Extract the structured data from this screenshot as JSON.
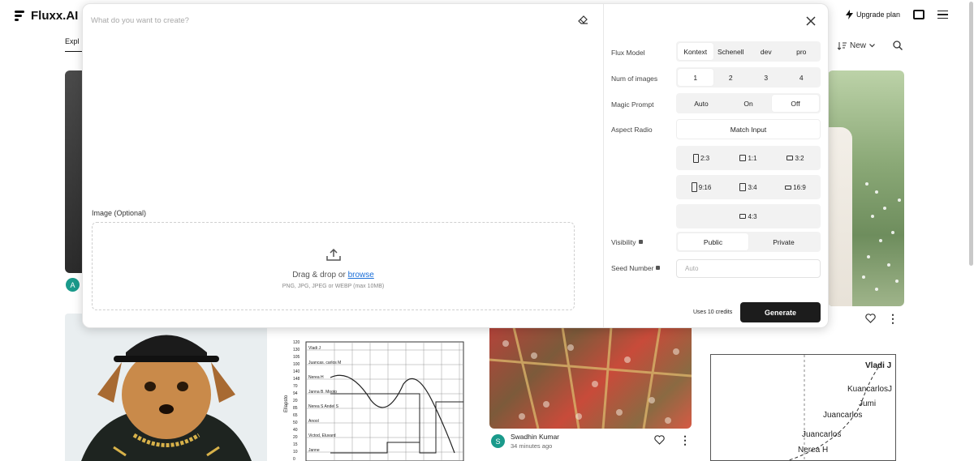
{
  "app": {
    "name": "Fluxx.AI"
  },
  "topbar": {
    "upgrade_label": "Upgrade plan"
  },
  "explore_tab": "Expl",
  "sort": {
    "label": "New"
  },
  "prompt": {
    "placeholder": "What do you want to create?"
  },
  "upload": {
    "label": "Image (Optional)",
    "drag_text": "Drag & drop or ",
    "browse_link": "browse",
    "hint": "PNG, JPG, JPEG or WEBP (max 10MB)"
  },
  "settings": {
    "flux_model": {
      "label": "Flux Model",
      "options": [
        "Kontext",
        "Schenell",
        "dev",
        "pro"
      ],
      "selected": "Kontext"
    },
    "num_images": {
      "label": "Num of images",
      "options": [
        "1",
        "2",
        "3",
        "4"
      ],
      "selected": "1"
    },
    "magic_prompt": {
      "label": "Magic Prompt",
      "options": [
        "Auto",
        "On",
        "Off"
      ],
      "selected": "Off"
    },
    "aspect": {
      "label": "Aspect Radio",
      "match_input": "Match Input",
      "row1": [
        "2:3",
        "1:1",
        "3:2"
      ],
      "row2": [
        "9:16",
        "3:4",
        "16:9"
      ],
      "row3": [
        "4:3"
      ]
    },
    "visibility": {
      "label": "Visibility",
      "options": [
        "Public",
        "Private"
      ],
      "selected": "Public"
    },
    "seed": {
      "label": "Seed Number",
      "placeholder": "Auto"
    },
    "credits_text": "Uses 10 credits",
    "generate_label": "Generate"
  },
  "gallery": {
    "avatar_letter_1": "A",
    "author": {
      "initial": "S",
      "name": "Swadhin Kumar",
      "time": "34 minutes ago"
    },
    "name_chart_labels": [
      "Vladi J",
      "KuancarlosJ",
      "Jumi",
      "Juancarlos",
      "Juancarlos",
      "Nerea H"
    ],
    "line_chart_rows": [
      "Vladi J",
      "Juancas. carlos M",
      "Nerea H",
      "Janna B. Mooto",
      "Nerea S Andel S",
      "Anool",
      "Victod, Eluvard",
      "Janne"
    ],
    "line_chart_yticks": [
      "120",
      "130",
      "105",
      "100",
      "140",
      "148",
      "70",
      "94",
      "20",
      "85",
      "65",
      "50",
      "40",
      "20",
      "15",
      "10",
      "0"
    ],
    "line_chart_ylabel": "Ellapsto"
  },
  "colors": {
    "accent": "#1c1c1c",
    "avatar": "#1a9a8b",
    "link": "#1a6ed8"
  }
}
